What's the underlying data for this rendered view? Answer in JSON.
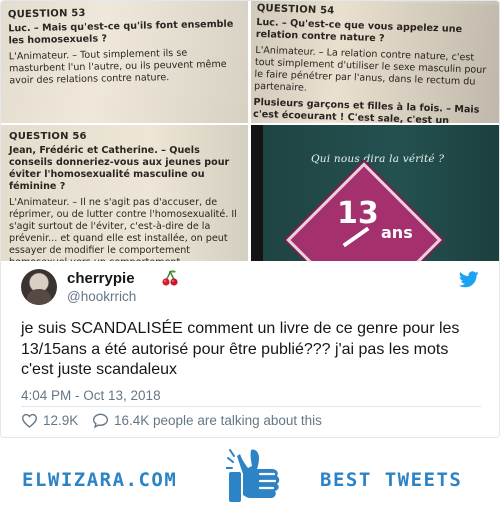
{
  "media": {
    "photo1": {
      "question_title": "QUESTION 53",
      "question_text": "Luc. – Mais qu'est-ce qu'ils font ensemble les homosexuels ?",
      "answer_text": "L'Animateur. – Tout simplement ils se masturbent l'un l'autre, ou ils peuvent même avoir des relations contre nature."
    },
    "photo2": {
      "question_title": "QUESTION 54",
      "question_text": "Luc. – Qu'est-ce que vous appelez une relation contre nature ?",
      "answer_text": "L'Animateur. – La relation contre nature, c'est tout simplement d'utiliser le sexe masculin pour le faire pénétrer par l'anus, dans le rectum du partenaire.",
      "extra_text": "Plusieurs garçons et filles à la fois. – Mais c'est écoeurant ! C'est sale, c'est un manque d'hy"
    },
    "photo3": {
      "question_title": "QUESTION 56",
      "question_text": "Jean, Frédéric et Catherine. – Quels conseils donneriez-vous aux jeunes pour éviter l'homosexualité masculine ou féminine ?",
      "answer_text": "L'Animateur. – Il ne s'agit pas d'accuser, de réprimer, ou de lutter contre l'homosexualité. Il s'agit surtout de l'éviter, c'est-à-dire de la prévenir... et quand elle est installée, on peut essayer de modifier le comportement homosexuel vers un comportement"
    },
    "photo4": {
      "cover_subtitle": "Qui nous dira la vérité ?",
      "cover_age": "13",
      "cover_unit": "ans"
    }
  },
  "tweet": {
    "display_name": "cherrypie",
    "handle": "@hookrrich",
    "text": "je suis SCANDALISÉE comment un livre de ce genre pour les 13/15ans a été autorisé pour être publié??? j'ai pas les mots c'est juste scandaleux",
    "timestamp": "4:04 PM - Oct 13, 2018",
    "like_count": "12.9K",
    "talking_text": "16.4K people are talking about this"
  },
  "icons": {
    "avatar": "avatar",
    "cherry": "cherry-icon",
    "twitter": "twitter-bird-icon",
    "heart": "heart-icon",
    "reply": "speech-bubble-icon",
    "thumb": "thumbs-up-icon"
  },
  "colors": {
    "twitter_blue": "#1da1f2",
    "footer_blue": "#2c83c5",
    "secondary_text": "#657786",
    "cover_magenta": "#a4316e",
    "cover_teal": "#245150"
  },
  "footer": {
    "site": "ELWIZARA.COM",
    "tagline": "BEST TWEETS"
  }
}
